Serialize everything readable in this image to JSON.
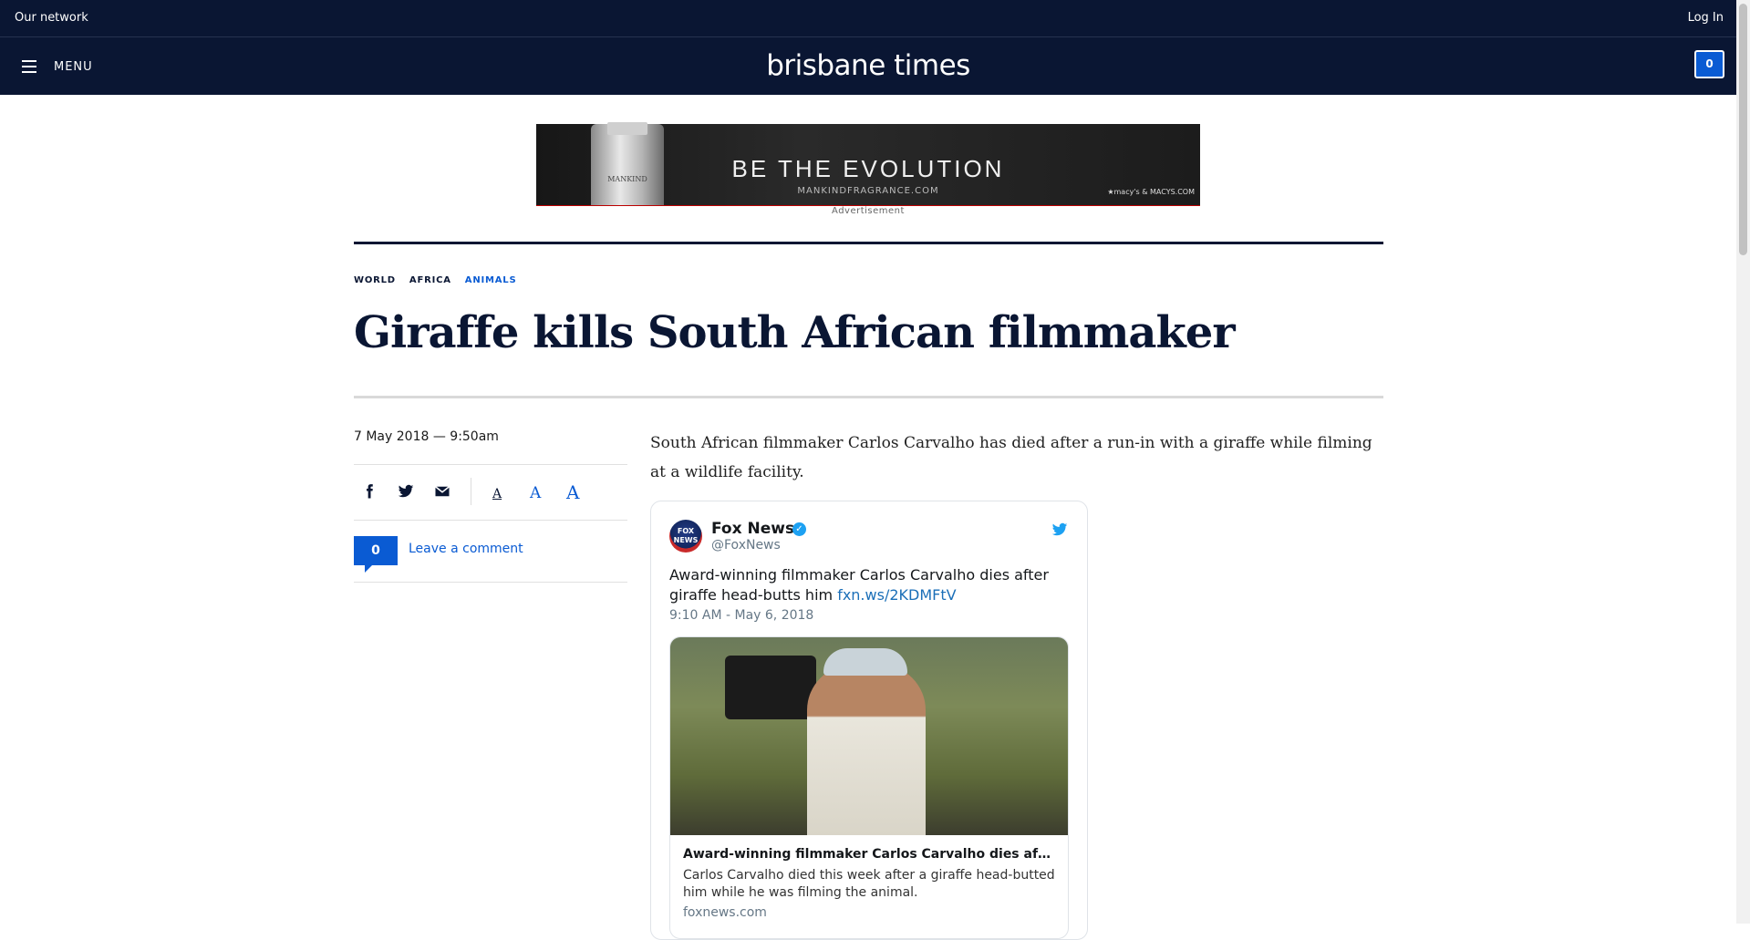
{
  "topbar": {
    "network_label": "Our network",
    "login_label": "Log In"
  },
  "header": {
    "menu_label": "MENU",
    "logo_text": "brisbane times",
    "count": "0"
  },
  "ad": {
    "headline": "BE THE EVOLUTION",
    "url": "MANKINDFRAGRANCE.COM",
    "bottle_brand": "MANKIND",
    "store": "★macy's & MACYS.COM",
    "label": "Advertisement"
  },
  "article": {
    "tags": [
      "WORLD",
      "AFRICA",
      "ANIMALS"
    ],
    "active_tag": "ANIMALS",
    "title": "Giraffe kills South African filmmaker",
    "date": "7 May 2018 — 9:50am",
    "comment_count": "0",
    "comment_label": "Leave a comment",
    "lede": "South African filmmaker Carlos Carvalho has died after a run-in with a giraffe while filming at a wildlife facility.",
    "font_sizes": [
      "A",
      "A",
      "A"
    ]
  },
  "tweet": {
    "avatar_text": "FOX NEWS",
    "name": "Fox News",
    "handle": "@FoxNews",
    "text": "Award-winning filmmaker Carlos Carvalho dies after giraffe head-butts him ",
    "link": "fxn.ws/2KDMFtV",
    "time": "9:10 AM - May 6, 2018",
    "card_title": "Award-winning filmmaker Carlos Carvalho dies af…",
    "card_desc": "Carlos Carvalho died this week after a giraffe head-butted him while he was filming the animal.",
    "card_domain": "foxnews.com"
  },
  "colors": {
    "navy": "#0a1633",
    "accent_blue": "#0a5bd3",
    "twitter_blue": "#1da1f2"
  }
}
